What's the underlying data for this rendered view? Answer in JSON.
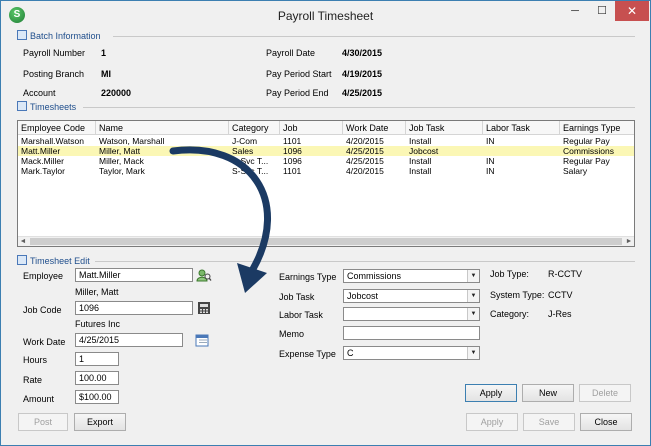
{
  "window": {
    "title": "Payroll Timesheet",
    "app_icon_letter": "S",
    "controls": {
      "minimize": "─",
      "maximize": "☐",
      "close": "✕"
    }
  },
  "batch_info": {
    "title": "Batch Information",
    "payroll_number_label": "Payroll Number",
    "payroll_number": "1",
    "posting_branch_label": "Posting Branch",
    "posting_branch": "MI",
    "account_label": "Account",
    "account": "220000",
    "payroll_date_label": "Payroll Date",
    "payroll_date": "4/30/2015",
    "period_start_label": "Pay Period Start",
    "period_start": "4/19/2015",
    "period_end_label": "Pay Period End",
    "period_end": "4/25/2015"
  },
  "timesheets": {
    "title": "Timesheets",
    "columns": [
      "Employee Code",
      "Name",
      "Category",
      "Job",
      "Work Date",
      "Job Task",
      "Labor Task",
      "Earnings Type"
    ],
    "rows": [
      [
        "Marshall.Watson",
        "Watson, Marshall",
        "J-Com",
        "1101",
        "4/20/2015",
        "Install",
        "IN",
        "Regular Pay"
      ],
      [
        "Matt.Miller",
        "Miller, Matt",
        "Sales",
        "1096",
        "4/25/2015",
        "Jobcost",
        "",
        "Commissions"
      ],
      [
        "Mack.Miller",
        "Miller, Mack",
        "S-Svc T...",
        "1096",
        "4/25/2015",
        "Install",
        "IN",
        "Regular Pay"
      ],
      [
        "Mark.Taylor",
        "Taylor, Mark",
        "S-Svc T...",
        "1101",
        "4/20/2015",
        "Install",
        "IN",
        "Salary"
      ]
    ],
    "selected_row": 1,
    "scroll_left": "◄",
    "scroll_right": "►"
  },
  "edit": {
    "title": "Timesheet Edit",
    "employee_label": "Employee",
    "employee": "Matt.Miller",
    "employee_name": "Miller, Matt",
    "job_code_label": "Job Code",
    "job_code": "1096",
    "job_name": "Futures  Inc",
    "work_date_label": "Work Date",
    "work_date": "4/25/2015",
    "hours_label": "Hours",
    "hours": "1",
    "rate_label": "Rate",
    "rate": "100.00",
    "amount_label": "Amount",
    "amount": "$100.00",
    "earnings_type_label": "Earnings Type",
    "earnings_type": "Commissions",
    "job_task_label": "Job Task",
    "job_task": "Jobcost",
    "labor_task_label": "Labor Task",
    "labor_task": "",
    "memo_label": "Memo",
    "memo": "",
    "expense_type_label": "Expense Type",
    "expense_type": "C",
    "job_type_label": "Job Type:",
    "job_type": "R-CCTV",
    "system_type_label": "System Type:",
    "system_type": "CCTV",
    "category_label": "Category:",
    "category": "J-Res",
    "dropdown_glyph": "▼"
  },
  "buttons": {
    "edit_apply": "Apply",
    "edit_new": "New",
    "edit_delete": "Delete",
    "post": "Post",
    "export": "Export",
    "apply": "Apply",
    "save": "Save",
    "close": "Close"
  },
  "colors": {
    "selected_row": "#fbf7b5",
    "arrow": "#1b3a63",
    "accent": "#1f4e8c"
  },
  "icons": {
    "employee_lookup": "person-search-icon",
    "job_lookup": "calculator-icon",
    "calendar": "calendar-icon"
  }
}
